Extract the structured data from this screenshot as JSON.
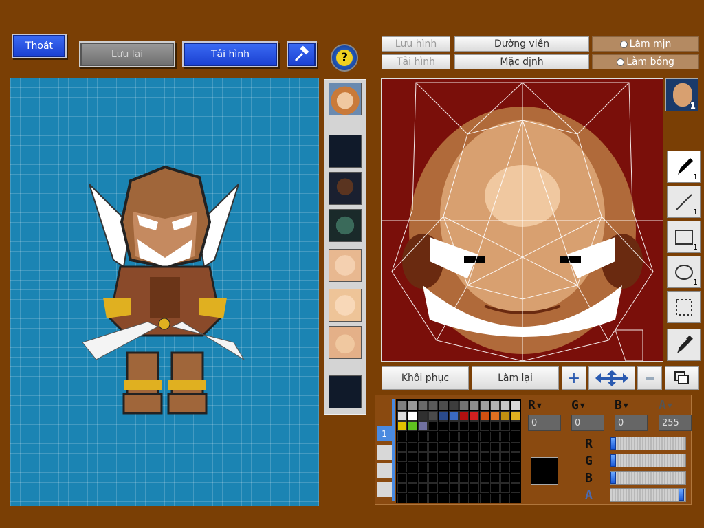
{
  "top_buttons": {
    "exit": "Thoát",
    "save": "Lưu lại",
    "reload": "Tải hình",
    "help": "?"
  },
  "texture_toolbar": {
    "save_image": "Lưu hình",
    "load_image": "Tải hình",
    "outline": "Đường viền",
    "default": "Mặc định",
    "smooth": "Làm mịn",
    "shade": "Làm bóng"
  },
  "tools": {
    "pen_size": "1",
    "line_size": "1",
    "rect_size": "1",
    "ellipse_size": "1",
    "face_layer": "1"
  },
  "bottom_buttons": {
    "restore": "Khôi phục",
    "redo": "Làm lại",
    "zoom_in": "+"
  },
  "color": {
    "labels": {
      "r": "R",
      "g": "G",
      "b": "B",
      "a": "A"
    },
    "r": "0",
    "g": "0",
    "b": "0",
    "a": "255",
    "r_level": 0,
    "g_level": 0,
    "b_level": 0,
    "a_level": 1,
    "current": "#000000",
    "palette_tab": "1",
    "swatches": [
      "#808080",
      "#999999",
      "#6a6a6a",
      "#5a5a5a",
      "#4d4d4d",
      "#3d3d3d",
      "#737373",
      "#8c8c8c",
      "#a0a0a0",
      "#b3b3b3",
      "#c6c6c6",
      "#d9d9d9",
      "#dcdcdc",
      "#ffffff",
      "#303030",
      "#4a4a4a",
      "#2a4a8a",
      "#3a6ac0",
      "#b01010",
      "#d02020",
      "#d05010",
      "#e07020",
      "#c09010",
      "#e0b020",
      "#e0c000",
      "#60c020",
      "#7070a0"
    ]
  }
}
